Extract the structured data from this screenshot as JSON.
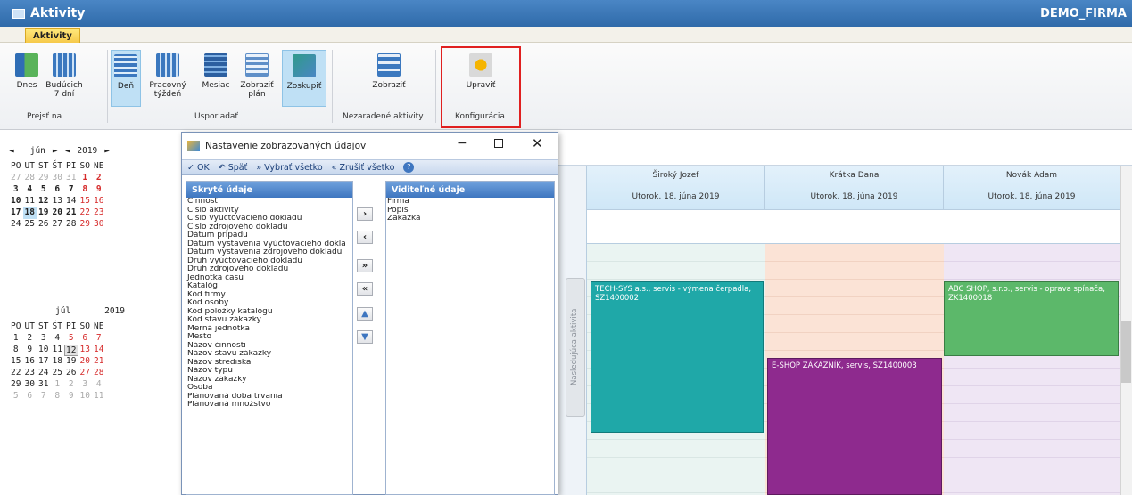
{
  "window": {
    "title": "Aktivity",
    "company": "DEMO_FIRMA"
  },
  "ribbon": {
    "tab": "Aktivity",
    "buttons": {
      "dnes": "Dnes",
      "buducich": "Budúcich",
      "buducich2": "7 dní",
      "den": "Deň",
      "pracovny": "Pracovný",
      "pracovny2": "týždeň",
      "mesiac": "Mesiac",
      "zobrazit_plan": "Zobraziť",
      "zobrazit_plan2": "plán",
      "zoskupit": "Zoskupiť",
      "zobrazit": "Zobraziť",
      "upravit": "Upraviť"
    },
    "groups": {
      "prejst": "Prejsť na",
      "usporiadat": "Usporiadať",
      "nezaradene": "Nezaradené aktivity",
      "konfiguracia": "Konfigurácia"
    }
  },
  "calendar": {
    "june": {
      "month": "jún",
      "year": "2019"
    },
    "july": {
      "month": "júl",
      "year": "2019"
    },
    "weekdays": [
      "PO",
      "UT",
      "ST",
      "ŠT",
      "PI",
      "SO",
      "NE"
    ]
  },
  "dialog": {
    "title": "Nastavenie zobrazovaných údajov",
    "toolbar": {
      "ok": "OK",
      "back": "Späť",
      "select_all": "Vybrať všetko",
      "cancel_all": "Zrušiť všetko"
    },
    "hidden_header": "Skryté údaje",
    "visible_header": "Viditeľné údaje",
    "hidden_items": [
      "Činnosť",
      "Číslo aktivity",
      "Číslo vyúčtovacieho dokladu",
      "Číslo zdrojového dokladu",
      "Dátum prípadu",
      "Dátum vystavenia vyúčtovacieho dokla",
      "Dátum vystavenia zdrojového dokladu",
      "Druh vyúčtovacieho dokladu",
      "Druh zdrojového dokladu",
      "Jednotka času",
      "Katalóg",
      "Kód firmy",
      "Kód osoby",
      "Kód položky katalógu",
      "Kód stavu zákazky",
      "Merná jednotka",
      "Mesto",
      "Názov činnosti",
      "Názov stavu zákazky",
      "Názov strediska",
      "Názov typu",
      "Názov zákazky",
      "Osoba",
      "Plánovaná doba trvania",
      "Plánovaná množstvo"
    ],
    "visible_items": [
      "Firma",
      "Popis",
      "Zákazka"
    ]
  },
  "schedule": {
    "next_activity": "Nasledujúca aktivita",
    "columns": [
      {
        "name": "Široký Jozef",
        "date": "Utorok, 18. júna 2019"
      },
      {
        "name": "Krátka Dana",
        "date": "Utorok, 18. júna 2019"
      },
      {
        "name": "Novák Adam",
        "date": "Utorok, 18. júna 2019"
      }
    ],
    "events": {
      "e1": "TECH-SYS a.s., servis - výmena čerpadla, SZ1400002",
      "e2": "E-SHOP ZÁKAZNÍK, servis, SZ1400003",
      "e3": "ABC SHOP, s.r.o., servis - oprava spínača, ZK1400018"
    },
    "colors": {
      "teal": "#1fa8a8",
      "purple": "#8e2a8e",
      "green": "#5cb86a"
    }
  }
}
